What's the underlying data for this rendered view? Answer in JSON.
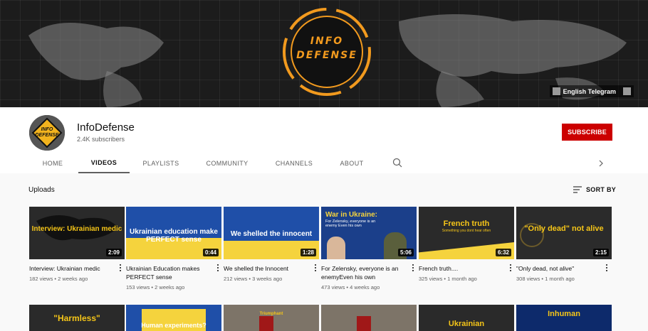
{
  "banner": {
    "logo_line1": "INFO",
    "logo_line2": "DEFENSE",
    "link_label": "English Telegram"
  },
  "channel": {
    "avatar_text_1": "INFO",
    "avatar_text_2": "DEFENSE",
    "name": "InfoDefense",
    "subscribers": "2.4K subscribers",
    "subscribe_label": "SUBSCRIBE"
  },
  "tabs": [
    {
      "label": "HOME"
    },
    {
      "label": "VIDEOS"
    },
    {
      "label": "PLAYLISTS"
    },
    {
      "label": "COMMUNITY"
    },
    {
      "label": "CHANNELS"
    },
    {
      "label": "ABOUT"
    }
  ],
  "section": {
    "title": "Uploads",
    "sort_label": "SORT BY"
  },
  "videos": [
    {
      "thumb_text": "Interview: Ukrainian medic",
      "duration": "2:09",
      "title": "Interview: Ukrainian medic",
      "meta": "182 views • 2 weeks ago"
    },
    {
      "thumb_text": "Ukrainian education make PERFECT sense",
      "duration": "0:44",
      "title": "Ukrainian Education makes PERFECT sense",
      "meta": "153 views • 2 weeks ago"
    },
    {
      "thumb_text": "We shelled the innocent",
      "duration": "1:28",
      "title": "We shelled the Innocent",
      "meta": "212 views • 3 weeks ago"
    },
    {
      "thumb_text": "War in Ukraine:",
      "thumb_sub": "For Zelensky, everyone is an enemy Even his own",
      "duration": "5:06",
      "title": "For Zelensky, everyone is an enemyEven his own",
      "meta": "473 views • 4 weeks ago"
    },
    {
      "thumb_text": "French truth",
      "thumb_sub": "Something you dont hear often",
      "duration": "6:32",
      "title": "French truth....",
      "meta": "325 views • 1 month ago"
    },
    {
      "thumb_text": "\"Only dead\" not alive",
      "duration": "2:15",
      "title": "\"Only dead, not alive\"",
      "meta": "308 views • 1 month ago"
    }
  ],
  "row2": [
    {
      "thumb_text": "\"Harmless\""
    },
    {
      "thumb_text": "Human experiments?"
    },
    {
      "thumb_text": "Triumphant"
    },
    {
      "thumb_text": ""
    },
    {
      "thumb_text": "Ukrainian"
    },
    {
      "thumb_text": "Inhuman"
    }
  ]
}
